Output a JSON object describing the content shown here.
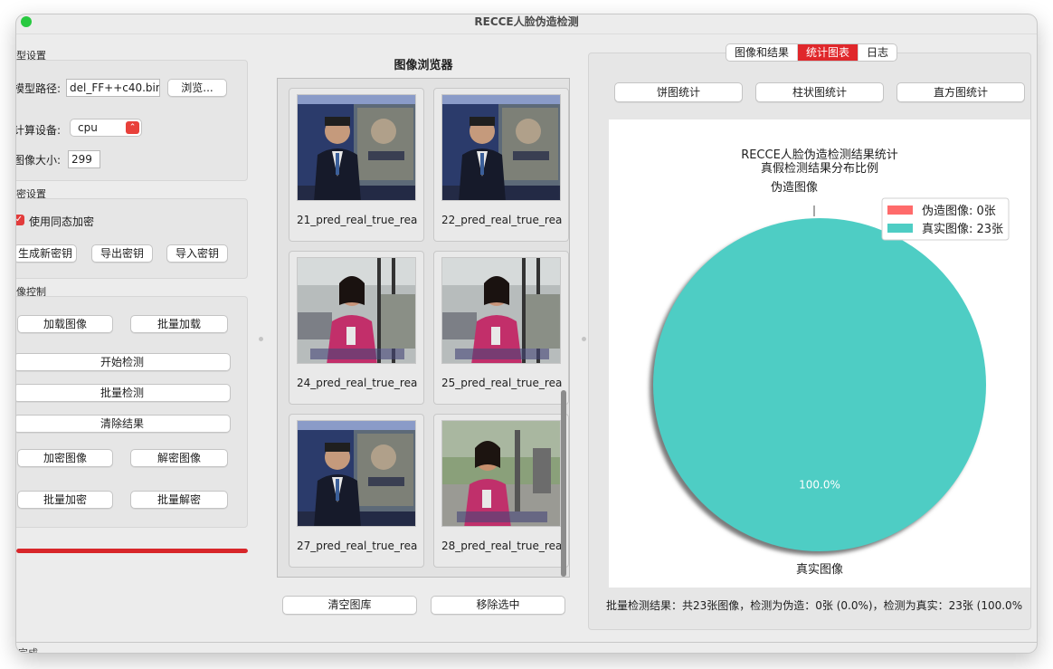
{
  "window": {
    "title": "RECCE人脸伪造检测"
  },
  "model_settings": {
    "group_title": "型设置",
    "model_path_label": "模型路径:",
    "model_path_value": "del_FF++c40.bin",
    "browse_label": "浏览...",
    "device_label": "计算设备:",
    "device_value": "cpu",
    "image_size_label": "图像大小:",
    "image_size_value": "299"
  },
  "encryption_settings": {
    "group_title": "密设置",
    "homomorphic_label": "使用同态加密",
    "homomorphic_checked": true,
    "gen_key_label": "生成新密钥",
    "export_key_label": "导出密钥",
    "import_key_label": "导入密钥"
  },
  "image_control": {
    "group_title": "像控制",
    "load_image": "加载图像",
    "batch_load": "批量加载",
    "start_detect": "开始检测",
    "batch_detect": "批量检测",
    "clear_results": "清除结果",
    "encrypt_image": "加密图像",
    "decrypt_image": "解密图像",
    "batch_encrypt": "批量加密",
    "batch_decrypt": "批量解密"
  },
  "progress": {
    "value_percent": 100,
    "color": "#d8262a"
  },
  "browser": {
    "title": "图像浏览器",
    "thumbnails": [
      {
        "label": "21_pred_real_true_rea",
        "scene": "studio"
      },
      {
        "label": "22_pred_real_true_rea",
        "scene": "studio"
      },
      {
        "label": "24_pred_real_true_rea",
        "scene": "street"
      },
      {
        "label": "25_pred_real_true_rea",
        "scene": "street"
      },
      {
        "label": "27_pred_real_true_rea",
        "scene": "studio"
      },
      {
        "label": "28_pred_real_true_rea",
        "scene": "street2"
      }
    ],
    "clear_gallery": "清空图库",
    "remove_selected": "移除选中"
  },
  "tabs": [
    {
      "label": "图像和结果",
      "active": false
    },
    {
      "label": "统计图表",
      "active": true
    },
    {
      "label": "日志",
      "active": false
    }
  ],
  "chart_buttons": {
    "pie": "饼图统计",
    "bar": "柱状图统计",
    "histogram": "直方图统计"
  },
  "chart_data": {
    "type": "pie",
    "title": "RECCE人脸伪造检测结果统计",
    "subtitle": "真假检测结果分布比例",
    "slices": [
      {
        "name": "伪造图像",
        "legend": "伪造图像: 0张",
        "value": 0,
        "pct_label": "0.0%",
        "color": "#ff6b6b"
      },
      {
        "name": "真实图像",
        "legend": "真实图像: 23张",
        "value": 23,
        "pct_label": "100.0%",
        "color": "#4ecdc4"
      }
    ],
    "legend_position": "top-right"
  },
  "result_summary": "批量检测结果：共23张图像，检测为伪造：0张 (0.0%)，检测为真实：23张 (100.0%",
  "statusbar": {
    "text": "完成"
  }
}
